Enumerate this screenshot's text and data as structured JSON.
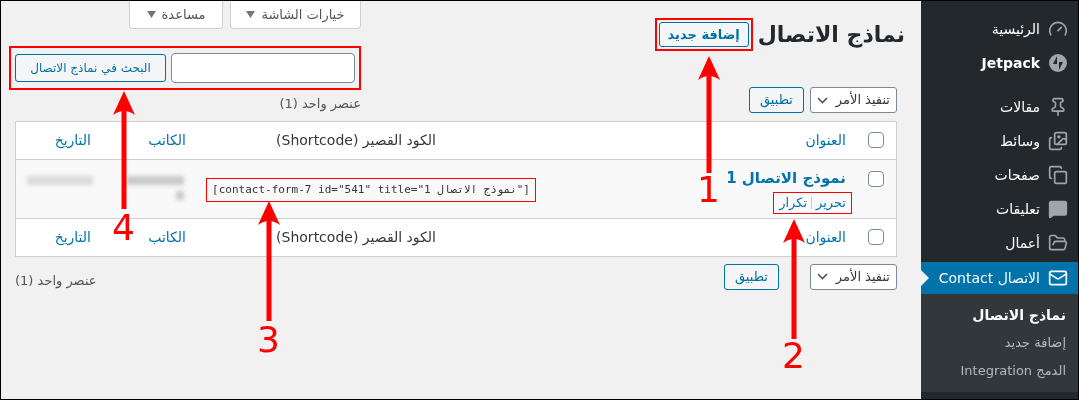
{
  "header_buttons": [
    {
      "label": "خيارات الشاشة"
    },
    {
      "label": "مساعدة"
    }
  ],
  "page_title": "نماذج الاتصال",
  "add_new": {
    "label": "إضافة جديد",
    "highlighted": true
  },
  "search": {
    "button": "البحث في نماذج الاتصال",
    "highlighted": true
  },
  "top_nav": {
    "bulk_action": "تنفيذ الأمر",
    "apply": "تطبيق",
    "count": "عنصر واحد (1)"
  },
  "table": {
    "header_checked": false,
    "columns": [
      {
        "label": "العنوان",
        "link": true
      },
      {
        "label": "الكود القصير (Shortcode)",
        "link": false
      },
      {
        "label": "الكاتب",
        "link": true
      },
      {
        "label": "التاريخ",
        "link": true
      }
    ],
    "rows": [
      {
        "checked": false,
        "title": "نموذج الاتصال 1",
        "actions": [
          {
            "label": "تحرير"
          },
          {
            "label": "تكرار"
          }
        ],
        "actions_highlighted": true,
        "shortcode": "[contact-form-7 id=\"541\" title=\"نموذج الاتصال 1\"]",
        "shortcode_highlighted": true
      }
    ],
    "footer_checked": false,
    "footer_columns": [
      {
        "label": "العنوان",
        "link": true
      },
      {
        "label": "الكود القصير (Shortcode)",
        "link": false
      },
      {
        "label": "الكاتب",
        "link": true
      },
      {
        "label": "التاريخ",
        "link": true
      }
    ]
  },
  "bottom_nav": {
    "bulk_action": "تنفيذ الأمر",
    "apply": "تطبيق",
    "count": "عنصر واحد (1)"
  },
  "sidebar": {
    "items": [
      {
        "label": "الرئيسية",
        "selected": false
      },
      {
        "label": "Jetpack",
        "selected": false
      },
      {
        "label": "مقالات",
        "selected": false
      },
      {
        "label": "وسائط",
        "selected": false
      },
      {
        "label": "صفحات",
        "selected": false
      },
      {
        "label": "تعليقات",
        "selected": false
      },
      {
        "label": "أعمال",
        "selected": false
      },
      {
        "label": "الاتصال Contact",
        "selected": true,
        "children": [
          {
            "label": "نماذج الاتصال",
            "selected": true
          },
          {
            "label": "إضافة جديد",
            "selected": false
          },
          {
            "label": "الدمج Integration",
            "selected": false
          }
        ]
      }
    ]
  },
  "annotations": [
    {
      "label": "1"
    },
    {
      "label": "2"
    },
    {
      "label": "3"
    },
    {
      "label": "4"
    }
  ]
}
